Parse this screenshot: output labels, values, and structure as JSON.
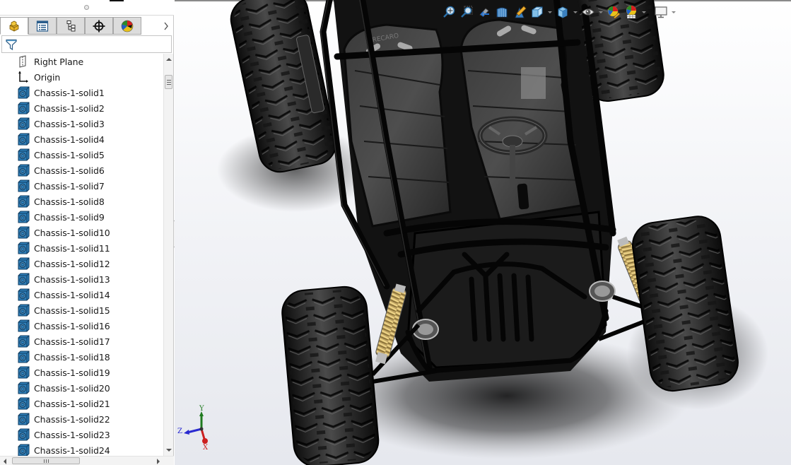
{
  "feature_manager": {
    "tabs": [
      {
        "name": "featuremanager-design-tree",
        "icon": "part-blocks-icon",
        "active": true
      },
      {
        "name": "property-manager",
        "icon": "property-list-icon",
        "active": false
      },
      {
        "name": "configuration-manager",
        "icon": "configuration-tree-icon",
        "active": false
      },
      {
        "name": "dimxpert-manager",
        "icon": "crosshair-target-icon",
        "active": false
      },
      {
        "name": "display-manager",
        "icon": "color-ball-icon",
        "active": false
      }
    ],
    "filter_icon": "funnel-filter-icon",
    "tree_items": [
      {
        "label": "Right Plane",
        "icon": "plane-icon"
      },
      {
        "label": "Origin",
        "icon": "origin-icon"
      },
      {
        "label": "Chassis-1-solid1",
        "icon": "solid-body-icon"
      },
      {
        "label": "Chassis-1-solid2",
        "icon": "solid-body-icon"
      },
      {
        "label": "Chassis-1-solid3",
        "icon": "solid-body-icon"
      },
      {
        "label": "Chassis-1-solid4",
        "icon": "solid-body-icon"
      },
      {
        "label": "Chassis-1-solid5",
        "icon": "solid-body-icon"
      },
      {
        "label": "Chassis-1-solid6",
        "icon": "solid-body-icon"
      },
      {
        "label": "Chassis-1-solid7",
        "icon": "solid-body-icon"
      },
      {
        "label": "Chassis-1-solid8",
        "icon": "solid-body-icon"
      },
      {
        "label": "Chassis-1-solid9",
        "icon": "solid-body-icon"
      },
      {
        "label": "Chassis-1-solid10",
        "icon": "solid-body-icon"
      },
      {
        "label": "Chassis-1-solid11",
        "icon": "solid-body-icon"
      },
      {
        "label": "Chassis-1-solid12",
        "icon": "solid-body-icon"
      },
      {
        "label": "Chassis-1-solid13",
        "icon": "solid-body-icon"
      },
      {
        "label": "Chassis-1-solid14",
        "icon": "solid-body-icon"
      },
      {
        "label": "Chassis-1-solid15",
        "icon": "solid-body-icon"
      },
      {
        "label": "Chassis-1-solid16",
        "icon": "solid-body-icon"
      },
      {
        "label": "Chassis-1-solid17",
        "icon": "solid-body-icon"
      },
      {
        "label": "Chassis-1-solid18",
        "icon": "solid-body-icon"
      },
      {
        "label": "Chassis-1-solid19",
        "icon": "solid-body-icon"
      },
      {
        "label": "Chassis-1-solid20",
        "icon": "solid-body-icon"
      },
      {
        "label": "Chassis-1-solid21",
        "icon": "solid-body-icon"
      },
      {
        "label": "Chassis-1-solid22",
        "icon": "solid-body-icon"
      },
      {
        "label": "Chassis-1-solid23",
        "icon": "solid-body-icon"
      },
      {
        "label": "Chassis-1-solid24",
        "icon": "solid-body-icon"
      }
    ]
  },
  "heads_up_toolbar": [
    {
      "name": "zoom-to-fit",
      "icon": "zoom-to-fit-icon",
      "dropdown": false
    },
    {
      "name": "zoom-to-area",
      "icon": "zoom-to-area-icon",
      "dropdown": false
    },
    {
      "name": "previous-view",
      "icon": "previous-view-icon",
      "dropdown": false
    },
    {
      "name": "section-view",
      "icon": "section-view-icon",
      "dropdown": false
    },
    {
      "name": "dynamic-annotation-views",
      "icon": "dynamic-annotation-icon",
      "dropdown": false
    },
    {
      "name": "view-orientation",
      "icon": "view-orientation-cube-icon",
      "dropdown": true
    },
    {
      "name": "display-style",
      "icon": "display-style-cube-icon",
      "dropdown": true
    },
    {
      "name": "hide-show-items",
      "icon": "eye-icon",
      "dropdown": true
    },
    {
      "name": "edit-appearance",
      "icon": "edit-appearance-icon",
      "dropdown": false
    },
    {
      "name": "apply-scene",
      "icon": "apply-scene-icon",
      "dropdown": true
    },
    {
      "name": "view-settings",
      "icon": "monitor-icon",
      "dropdown": true
    }
  ],
  "model": {
    "description": "Off-road buggy chassis with roll cage, two bucket seats, steering wheel, four knobby tires and coil-over shocks",
    "seat_brand_text": "RECARO",
    "spring_color": "#d8b45a",
    "body_color": "#1a1a1a"
  },
  "triad": {
    "x_label": "X",
    "y_label": "Y",
    "z_label": "Z",
    "x_color": "#cc1f1f",
    "y_color": "#1f7a1f",
    "z_color": "#2a2ad0"
  }
}
